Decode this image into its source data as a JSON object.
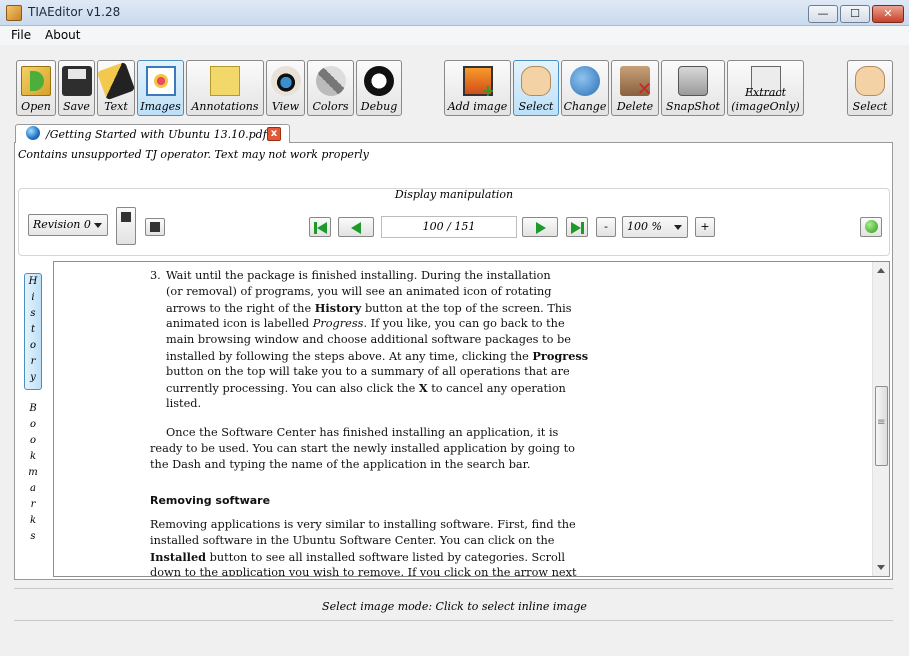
{
  "window": {
    "title": "TIAEditor v1.28"
  },
  "menu": {
    "file": "File",
    "about": "About"
  },
  "toolbar": {
    "open": "Open",
    "save": "Save",
    "text": "Text",
    "images": "Images",
    "annotations": "Annotations",
    "view": "View",
    "colors": "Colors",
    "debug": "Debug",
    "add_image": "Add image",
    "select": "Select",
    "change": "Change",
    "delete": "Delete",
    "snapshot": "SnapShot",
    "extract_line1": "Extract",
    "extract_line2": "(imageOnly)",
    "select_right": "Select"
  },
  "tab": {
    "label": "/Getting Started with Ubuntu 13.10.pdf",
    "close": "x"
  },
  "warning": "Contains unsupported TJ operator. Text may not work properly",
  "display": {
    "title": "Display manipulation",
    "revision": "Revision 0",
    "page": "100 / 151",
    "zoom": "100 %",
    "minus": "-",
    "plus": "+"
  },
  "side": {
    "history": [
      "H",
      "i",
      "s",
      "t",
      "o",
      "r",
      "y"
    ],
    "bookmarks": [
      "B",
      "o",
      "o",
      "k",
      "m",
      "a",
      "r",
      "k",
      "s"
    ]
  },
  "content": {
    "item_number": "3.",
    "lines_item": [
      "Wait until the package is finished installing. During the installation",
      "(or removal) of programs, you will see an animated icon of rotating"
    ],
    "l3_a": "arrows to the right of the ",
    "l3_b": "History",
    "l3_c": " button at the top of the screen. This",
    "l4_a": "animated icon is labelled ",
    "l4_b": "Progress",
    "l4_c": ". If you like, you can go back to the",
    "l5": "main browsing window and choose additional software packages to be",
    "l6_a": "installed by following the steps above. At any time, clicking the ",
    "l6_b": "Progress",
    "l7": "button on the top will take you to a summary of all operations that are",
    "l8_a": "currently processing. You can also click the ",
    "l8_b": "X",
    "l8_c": " to cancel any operation",
    "l9": "listed.",
    "p2": [
      "Once the Software Center has finished installing an application, it is",
      "ready to be used. You can start the newly installed application by going to",
      "the Dash and typing the name of the application in the search bar."
    ],
    "heading": "Removing software",
    "p3_1": "Removing applications is very similar to installing software. First, find the",
    "p3_2": "installed software in the Ubuntu Software Center. You can click on the",
    "p3_3_a": "Installed",
    "p3_3_b": " button to see all installed software listed by categories. Scroll",
    "p3_4": "down to the application you wish to remove. If you click on the arrow next"
  },
  "status": "Select image mode: Click to select inline image"
}
